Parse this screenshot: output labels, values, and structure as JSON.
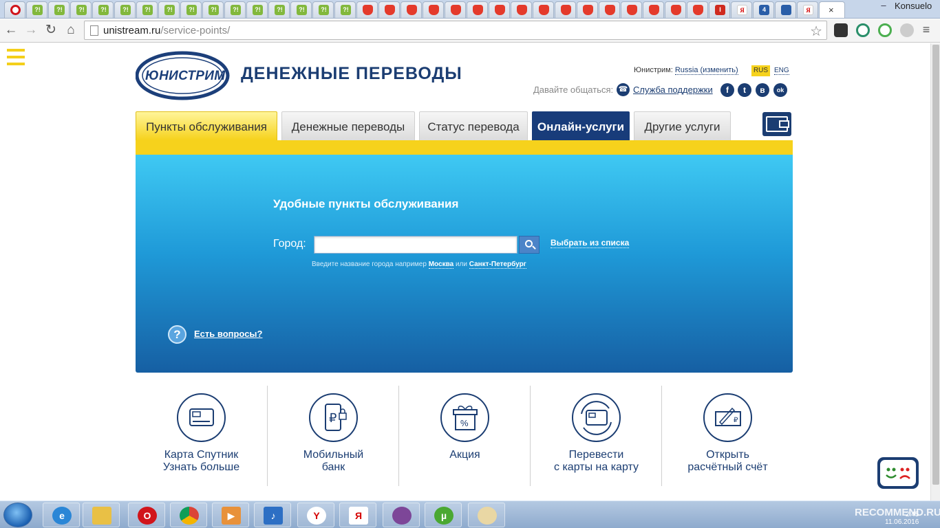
{
  "browser": {
    "tab_favicons": [
      "opera",
      "?!",
      "?!",
      "?!",
      "?!",
      "?!",
      "?!",
      "?!",
      "?!",
      "?!",
      "?!",
      "?!",
      "?!",
      "?!",
      "?!",
      "?!",
      "mail",
      "mail",
      "mail",
      "mail",
      "mail",
      "mail",
      "mail",
      "mail",
      "mail",
      "mail",
      "mail",
      "mail",
      "mail",
      "mail",
      "mail",
      "mail",
      "I",
      "Я",
      "4",
      "ie",
      "Я"
    ],
    "tab_q_label": "?!",
    "tab_i_label": "I",
    "tab_ya_label": "Я",
    "tab_4_label": "4",
    "active_tab_close": "×",
    "user_name": "Konsuelo",
    "window_controls": {
      "minimize": "–",
      "maximize": "□",
      "close": "×"
    },
    "url_host": "unistream.ru",
    "url_path": "/service-points/",
    "nav": {
      "back": "←",
      "forward": "→",
      "reload": "↻",
      "home": "⌂"
    },
    "bookmark_star": "☆"
  },
  "header": {
    "logo_text": "ЮНИСТРИМ",
    "brand_title": "ДЕНЕЖНЫЕ ПЕРЕВОДЫ",
    "region_label": "Юнистрим:",
    "region_value": "Russia (изменить)",
    "lang_rus": "RUS",
    "lang_eng": "ENG",
    "contact_label": "Давайте общаться:",
    "support_link": "Служба поддержки",
    "phone_icon": "☎",
    "social": [
      "f",
      "t",
      "в",
      "ok"
    ]
  },
  "tabs": [
    {
      "label": "Пункты обслуживания",
      "state": "active"
    },
    {
      "label": "Денежные переводы",
      "state": "normal"
    },
    {
      "label": "Статус перевода",
      "state": "normal"
    },
    {
      "label": "Онлайн-услуги",
      "state": "dark"
    },
    {
      "label": "Другие услуги",
      "state": "normal"
    }
  ],
  "hero": {
    "title": "Удобные пункты обслуживания",
    "city_label": "Город:",
    "city_value": "",
    "choose_from_list": "Выбрать из списка",
    "hint_prefix": "Введите название города например",
    "hint_city1": "Москва",
    "hint_or": "или",
    "hint_city2": "Санкт-Петербург",
    "faq_icon": "?",
    "faq_link": "Есть вопросы?"
  },
  "services": [
    {
      "line1": "Карта Спутник",
      "line2": "Узнать больше",
      "icon": "card-icon"
    },
    {
      "line1": "Мобильный",
      "line2": "банк",
      "icon": "mobile-ruble-icon"
    },
    {
      "line1": "Акция",
      "line2": "",
      "icon": "gift-percent-icon"
    },
    {
      "line1": "Перевести",
      "line2": "с карты на карту",
      "icon": "card-transfer-icon"
    },
    {
      "line1": "Открыть",
      "line2": "расчётный счёт",
      "icon": "check-sign-icon"
    }
  ],
  "chat_widget": {
    "face": "ᵕᴗᵕ ☹"
  },
  "taskbar": {
    "tray_time": "2:45",
    "tray_date": "11.06.2016",
    "watermark": "RECOMMEND.RU",
    "apps": [
      "ie",
      "explorer",
      "opera",
      "chrome",
      "media",
      "sound",
      "yandex",
      "yandex-browser",
      "tor",
      "utorrent",
      "paint"
    ]
  },
  "colors": {
    "brand_blue": "#1b3d72",
    "accent_yellow": "#f6d21c",
    "hero_top": "#3fc9f3",
    "hero_bottom": "#165fa3"
  }
}
